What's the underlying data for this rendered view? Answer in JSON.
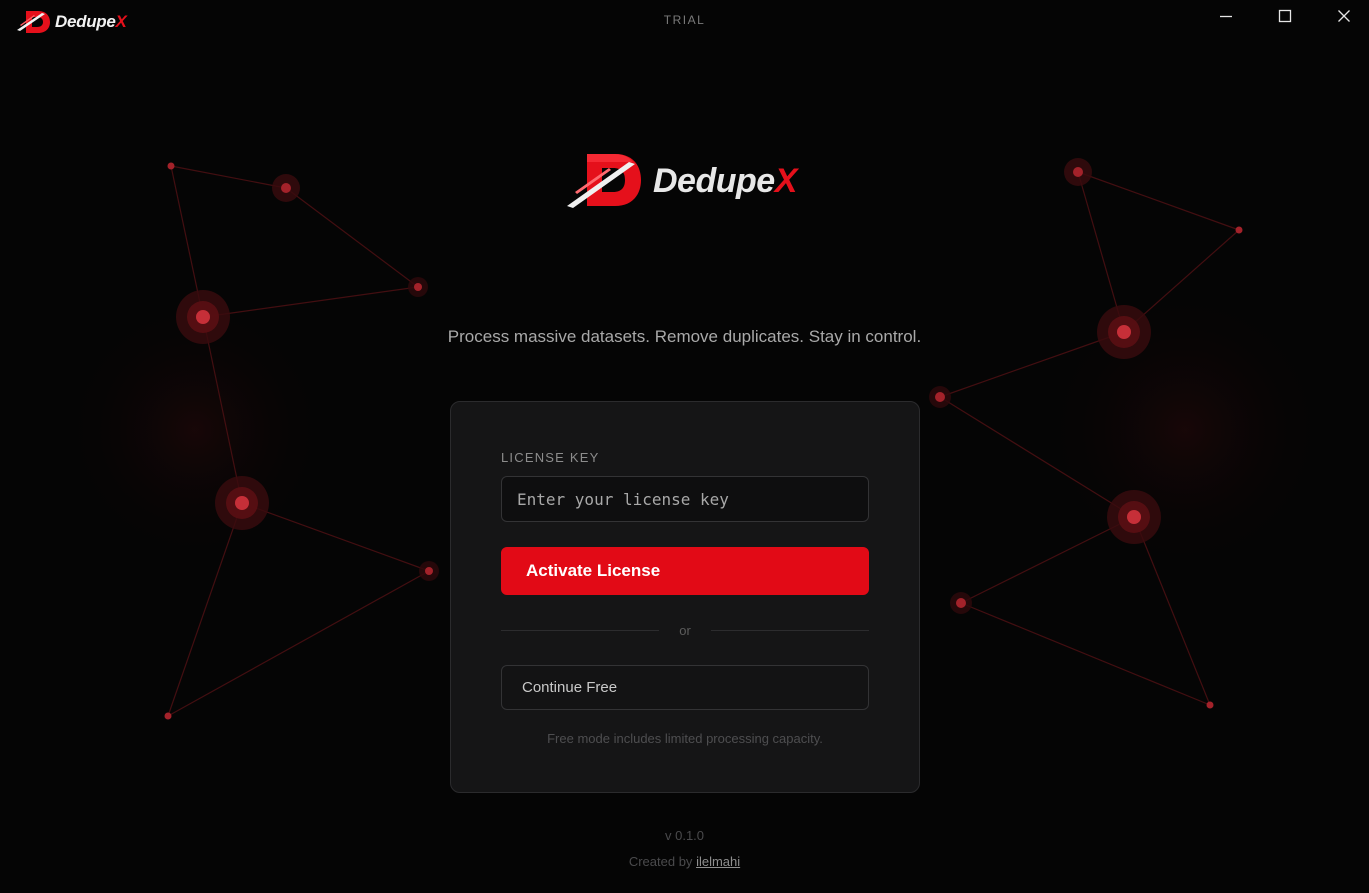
{
  "titlebar": {
    "app_name": "Dedupe",
    "app_name_accent": "X",
    "status": "TRIAL",
    "minimize_icon": "minimize-icon",
    "maximize_icon": "maximize-icon",
    "close_icon": "close-icon"
  },
  "hero": {
    "brand": "Dedupe",
    "brand_accent": "X",
    "tagline": "Process massive datasets. Remove duplicates. Stay in control."
  },
  "license": {
    "label": "LICENSE KEY",
    "input_value": "",
    "input_placeholder": "Enter your license key",
    "activate_label": "Activate License",
    "divider_text": "or",
    "continue_label": "Continue Free",
    "free_note": "Free mode includes limited processing capacity."
  },
  "footer": {
    "version": "v 0.1.0",
    "created_by": "Created by",
    "author": "ilelmahi"
  },
  "colors": {
    "accent": "#e20a16",
    "background": "#050505",
    "card": "#151516"
  }
}
